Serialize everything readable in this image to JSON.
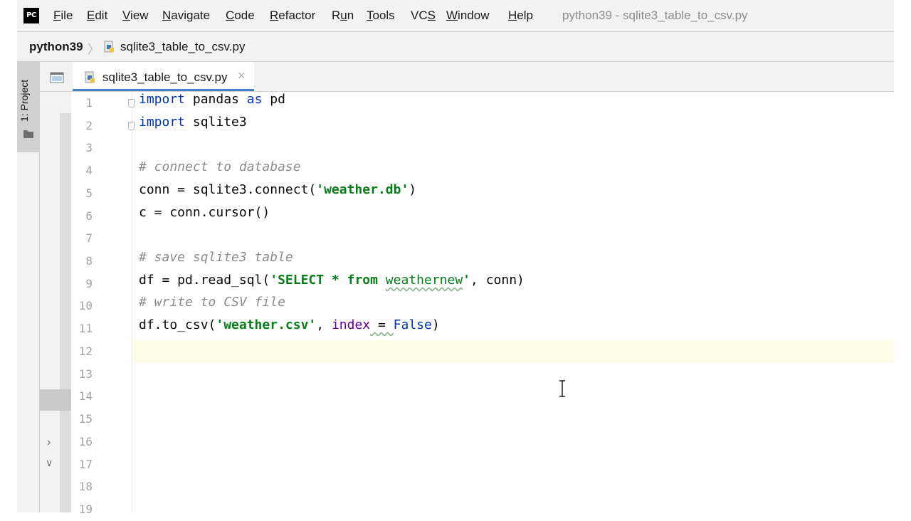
{
  "app": {
    "logo_text": "PC",
    "menu": [
      {
        "pre": "",
        "key": "F",
        "rest": "ile"
      },
      {
        "pre": "",
        "key": "E",
        "rest": "dit"
      },
      {
        "pre": "",
        "key": "V",
        "rest": "iew"
      },
      {
        "pre": "",
        "key": "N",
        "rest": "avigate"
      },
      {
        "pre": "",
        "key": "C",
        "rest": "ode"
      },
      {
        "pre": "",
        "key": "R",
        "rest": "efactor"
      },
      {
        "pre": "R",
        "key": "u",
        "rest": "n"
      },
      {
        "pre": "",
        "key": "T",
        "rest": "ools"
      },
      {
        "pre": "VC",
        "key": "S",
        "rest": ""
      },
      {
        "pre": "",
        "key": "W",
        "rest": "indow"
      },
      {
        "pre": "",
        "key": "H",
        "rest": "elp"
      }
    ],
    "window_title": "python39 - sqlite3_table_to_csv.py"
  },
  "navbar": {
    "project": "python39",
    "separator": "〉",
    "file": "sqlite3_table_to_csv.py"
  },
  "toolwindow": {
    "project_label": "1: Project"
  },
  "editor": {
    "tab": {
      "label": "sqlite3_table_to_csv.py",
      "close": "×"
    },
    "line_numbers": [
      "1",
      "2",
      "3",
      "4",
      "5",
      "6",
      "7",
      "8",
      "9",
      "10",
      "11",
      "12",
      "13",
      "14",
      "15",
      "16",
      "17",
      "18",
      "19"
    ],
    "current_line": 12,
    "code": {
      "l1_kw1": "import",
      "l1_mid": " pandas ",
      "l1_kw2": "as",
      "l1_end": " pd",
      "l2_kw": "import",
      "l2_end": " sqlite3",
      "l4": "# connect to database",
      "l5_a": "conn = sqlite3.connect(",
      "l5_str": "'weather.db'",
      "l5_b": ")",
      "l6": "c = conn.cursor()",
      "l8": "# save sqlite3 table",
      "l9_a": "df = pd.read_sql(",
      "l9_str1": "'SELECT * from ",
      "l9_str2": "weathernew",
      "l9_str3": "'",
      "l9_b": ", conn)",
      "l10": "# write to CSV file",
      "l11_a": "df.to_csv(",
      "l11_str": "'weather.csv'",
      "l11_b": ", ",
      "l11_param": "index",
      "l11_c": " = ",
      "l11_kw": "False",
      "l11_d": ")"
    }
  },
  "colors": {
    "keyword": "#0033b3",
    "string": "#067d17",
    "comment": "#8c8c8c",
    "parameter": "#660099",
    "tab_underline": "#4083c9",
    "current_line": "#fefde8"
  }
}
